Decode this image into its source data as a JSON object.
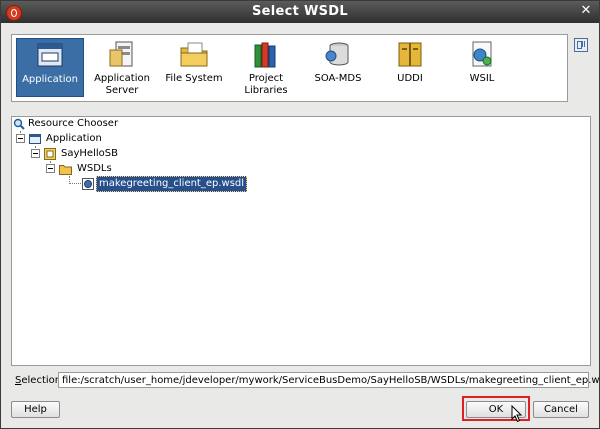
{
  "window": {
    "title": "Select WSDL"
  },
  "catalog": {
    "items": [
      {
        "label": "Application",
        "selected": true,
        "icon": "application-icon"
      },
      {
        "label": "Application Server",
        "selected": false,
        "icon": "application-server-icon"
      },
      {
        "label": "File System",
        "selected": false,
        "icon": "file-system-icon"
      },
      {
        "label": "Project Libraries",
        "selected": false,
        "icon": "project-libraries-icon"
      },
      {
        "label": "SOA-MDS",
        "selected": false,
        "icon": "soa-mds-icon"
      },
      {
        "label": "UDDI",
        "selected": false,
        "icon": "uddi-icon"
      },
      {
        "label": "WSIL",
        "selected": false,
        "icon": "wsil-icon"
      }
    ]
  },
  "tree": {
    "root": "Resource Chooser",
    "application": "Application",
    "project": "SayHelloSB",
    "folder": "WSDLs",
    "file": "makegreeting_client_ep.wsdl"
  },
  "selection": {
    "label_prefix": "S",
    "label_rest": "election:",
    "value": "file:/scratch/user_home/jdeveloper/mywork/ServiceBusDemo/SayHelloSB/WSDLs/makegreeting_client_ep.wsdl"
  },
  "buttons": {
    "help": "Help",
    "ok": "OK",
    "cancel": "Cancel"
  },
  "colors": {
    "selection": "#3a6ea5",
    "highlight": "#e02020",
    "titlebar": "#3c3c3c"
  }
}
